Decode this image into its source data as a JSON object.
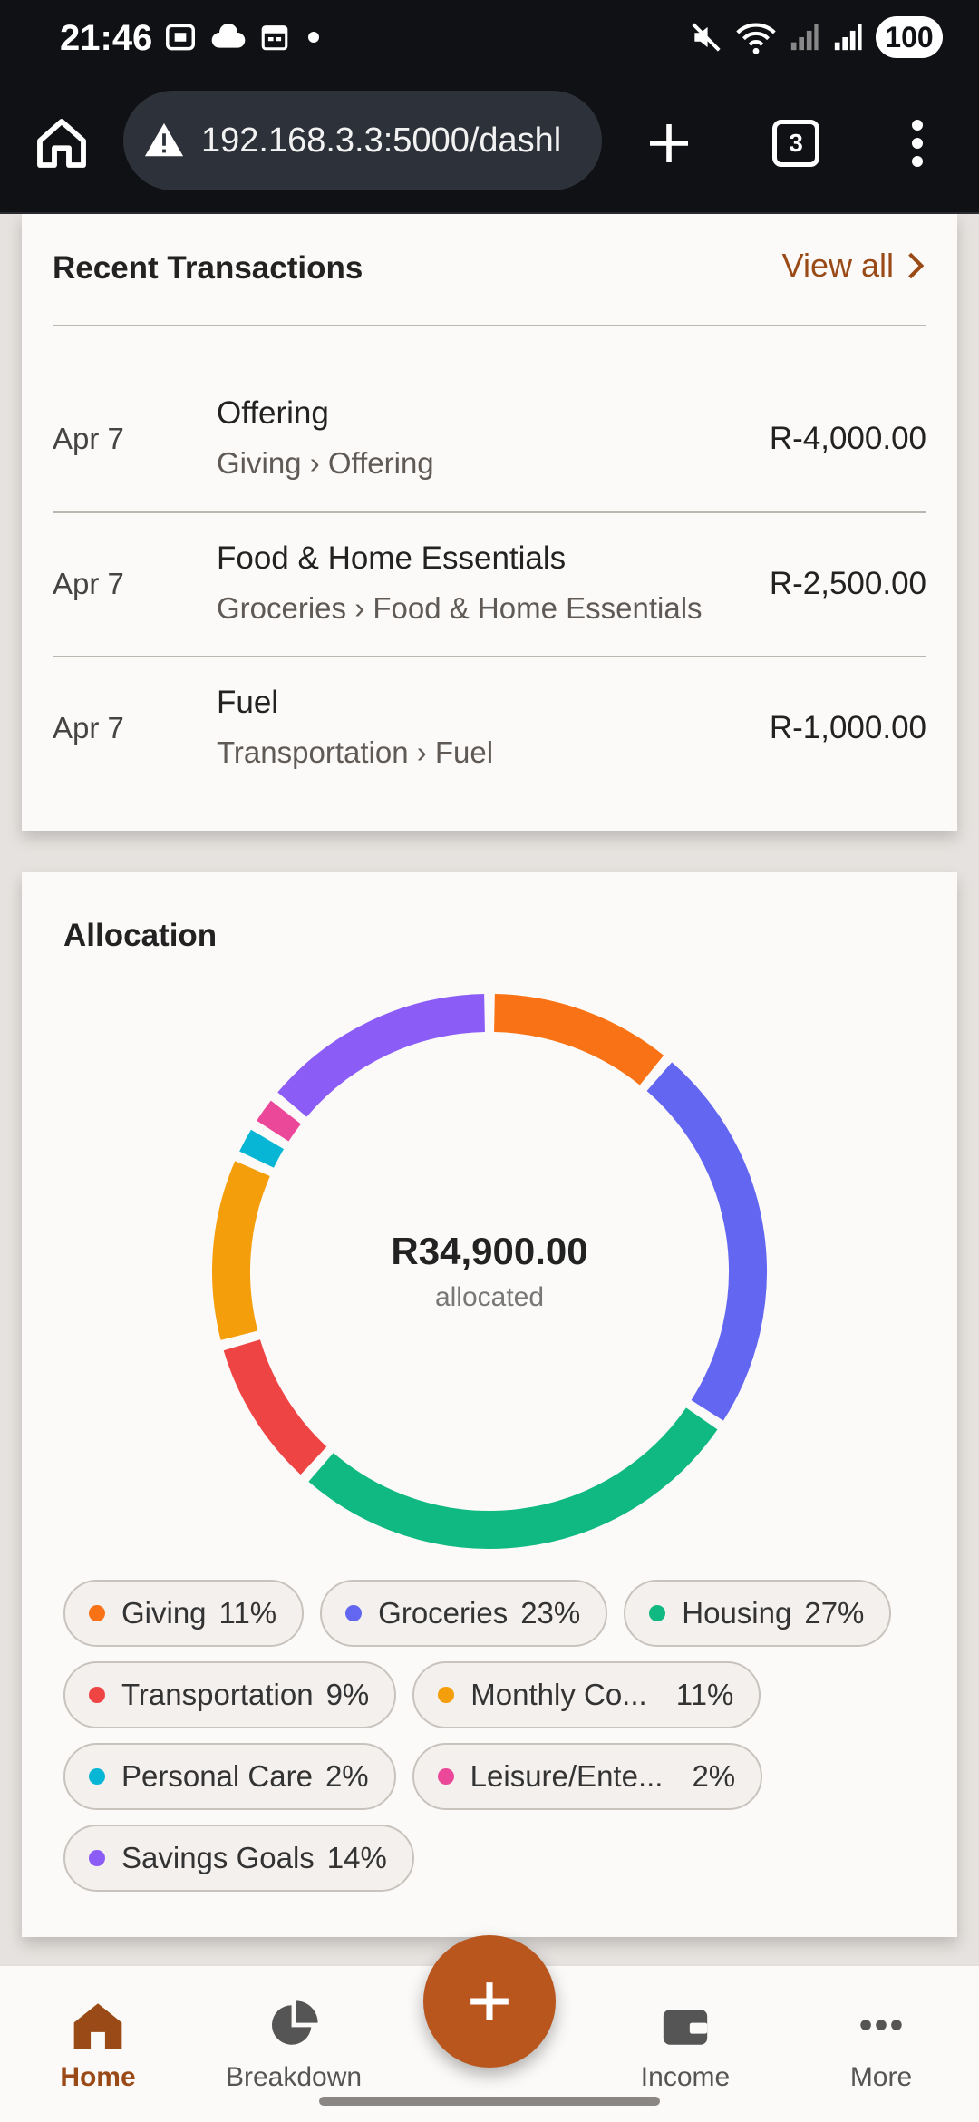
{
  "status_bar": {
    "time": "21:46",
    "battery": "100",
    "icons": [
      "screenshot-icon",
      "cloud-icon",
      "calendar-icon",
      "dot-icon",
      "mute-icon",
      "wifi-icon",
      "signal-icon",
      "signal-icon"
    ]
  },
  "browser": {
    "url": "192.168.3.3:5000/dashl",
    "tab_count": "3",
    "icons": [
      "home-icon",
      "warning-icon",
      "new-tab-icon",
      "menu-icon"
    ]
  },
  "transactions": {
    "title": "Recent Transactions",
    "view_all": "View all",
    "rows": [
      {
        "date": "Apr 7",
        "name": "Offering",
        "category": "Giving › Offering",
        "amount": "R-4,000.00"
      },
      {
        "date": "Apr 7",
        "name": "Food & Home Essentials",
        "category": "Groceries › Food & Home Essentials",
        "amount": "R-2,500.00"
      },
      {
        "date": "Apr 7",
        "name": "Fuel",
        "category": "Transportation › Fuel",
        "amount": "R-1,000.00"
      }
    ]
  },
  "allocation": {
    "title": "Allocation",
    "total": "R34,900.00",
    "total_label": "allocated",
    "legend": [
      {
        "label": "Giving",
        "pct": "11%",
        "color": "#f97316"
      },
      {
        "label": "Groceries",
        "pct": "23%",
        "color": "#6366f1"
      },
      {
        "label": "Housing",
        "pct": "27%",
        "color": "#10b981"
      },
      {
        "label": "Transportation",
        "pct": "9%",
        "color": "#ef4444"
      },
      {
        "label": "Monthly Co...",
        "pct": "11%",
        "color": "#f59e0b"
      },
      {
        "label": "Personal Care",
        "pct": "2%",
        "color": "#06b6d4"
      },
      {
        "label": "Leisure/Ente...",
        "pct": "2%",
        "color": "#ec4899"
      },
      {
        "label": "Savings Goals",
        "pct": "14%",
        "color": "#8b5cf6"
      }
    ]
  },
  "chart_data": {
    "type": "pie",
    "categories": [
      "Giving",
      "Groceries",
      "Housing",
      "Transportation",
      "Monthly Co...",
      "Personal Care",
      "Leisure/Ente...",
      "Savings Goals"
    ],
    "values": [
      11,
      23,
      27,
      9,
      11,
      2,
      2,
      14
    ],
    "colors": [
      "#f97316",
      "#6366f1",
      "#10b981",
      "#ef4444",
      "#f59e0b",
      "#06b6d4",
      "#ec4899",
      "#8b5cf6"
    ],
    "title": "Allocation"
  },
  "bottom_nav": {
    "items": [
      {
        "label": "Home",
        "icon": "home-icon"
      },
      {
        "label": "Breakdown",
        "icon": "pie-chart-icon"
      },
      {
        "label": "Income",
        "icon": "wallet-icon"
      },
      {
        "label": "More",
        "icon": "more-icon"
      }
    ],
    "fab_icon": "plus-icon"
  }
}
